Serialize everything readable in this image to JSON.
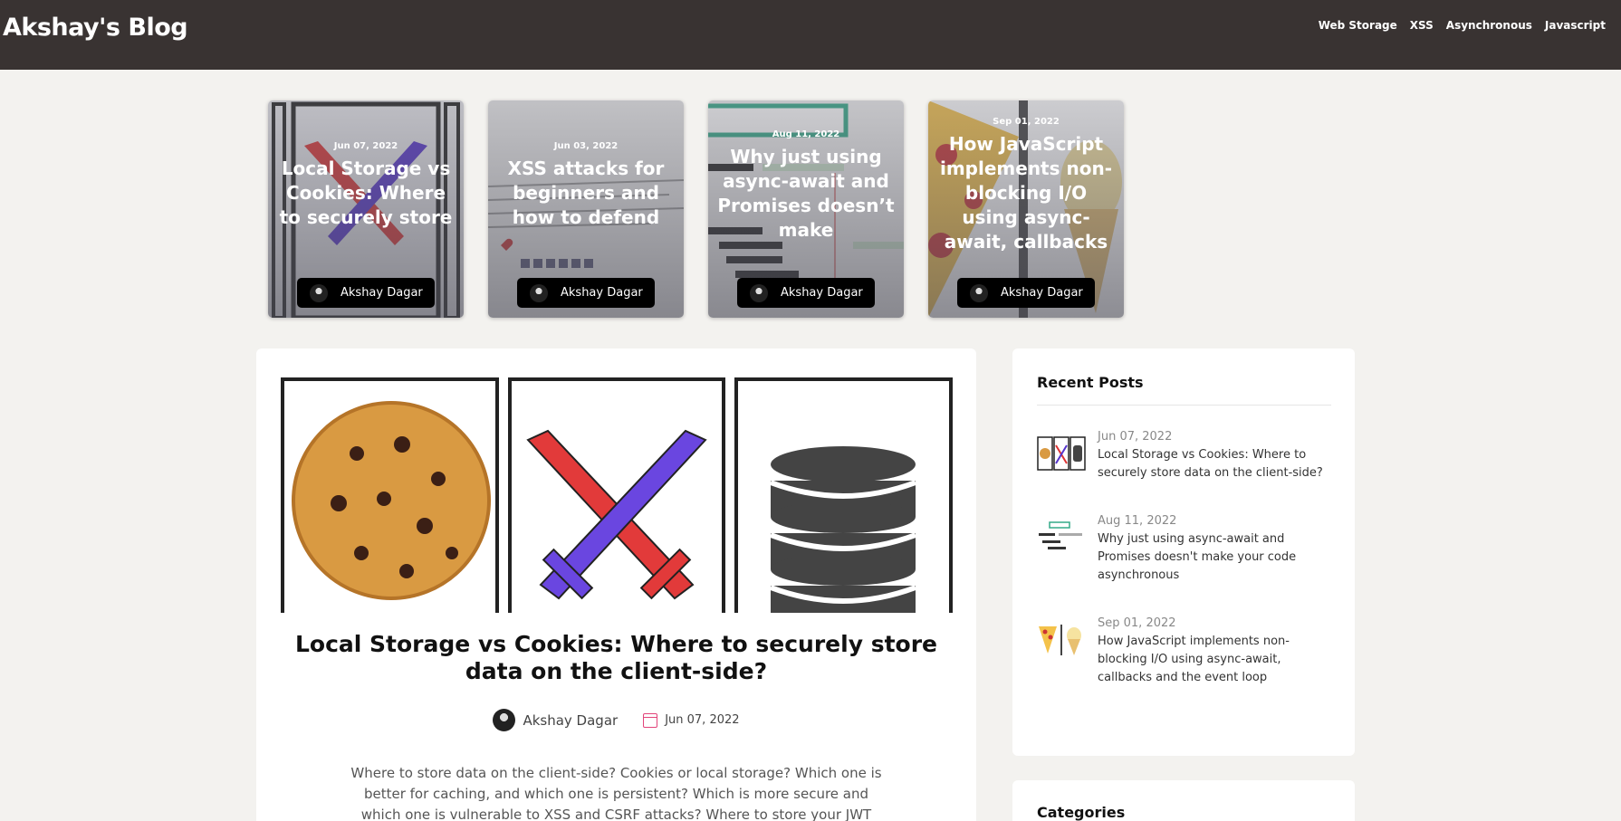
{
  "header": {
    "brand": "Akshay's Blog",
    "nav": [
      "Web Storage",
      "XSS",
      "Asynchronous",
      "Javascript"
    ]
  },
  "featured": [
    {
      "date": "Jun 07, 2022",
      "title": "Local Storage vs Cookies: Where to securely store",
      "author": "Akshay Dagar"
    },
    {
      "date": "Jun 03, 2022",
      "title": "XSS attacks for beginners and how to defend",
      "author": "Akshay Dagar"
    },
    {
      "date": "Aug 11, 2022",
      "title": "Why just using async-await and Promises doesn’t make",
      "author": "Akshay Dagar"
    },
    {
      "date": "Sep 01, 2022",
      "title": "How JavaScript implements non-blocking I/O using async-await, callbacks",
      "author": "Akshay Dagar"
    }
  ],
  "article": {
    "title": "Local Storage vs Cookies: Where to securely store data on the client-side?",
    "author": "Akshay Dagar",
    "date": "Jun 07, 2022",
    "excerpt": "Where to store data on the client-side? Cookies or local storage? Which one is better for caching, and which one is persistent? Which is more secure and which one is vulnerable to XSS and CSRF attacks? Where to store your JWT access"
  },
  "sidebar": {
    "recent_title": "Recent Posts",
    "recent": [
      {
        "date": "Jun 07, 2022",
        "title": "Local Storage vs Cookies: Where to securely store data on the client-side?"
      },
      {
        "date": "Aug 11, 2022",
        "title": "Why just using async-await and Promises doesn't make your code asynchronous"
      },
      {
        "date": "Sep 01, 2022",
        "title": "How JavaScript implements non-blocking I/O using async-await, callbacks and the event loop"
      }
    ],
    "categories_title": "Categories"
  },
  "colors": {
    "header_bg": "#393332",
    "page_bg": "#f3f2ef",
    "accent": "#e2447a"
  },
  "icons": [
    "author-avatar-icon",
    "calendar-icon",
    "cookie-icon",
    "crossed-swords-icon",
    "database-icon"
  ]
}
